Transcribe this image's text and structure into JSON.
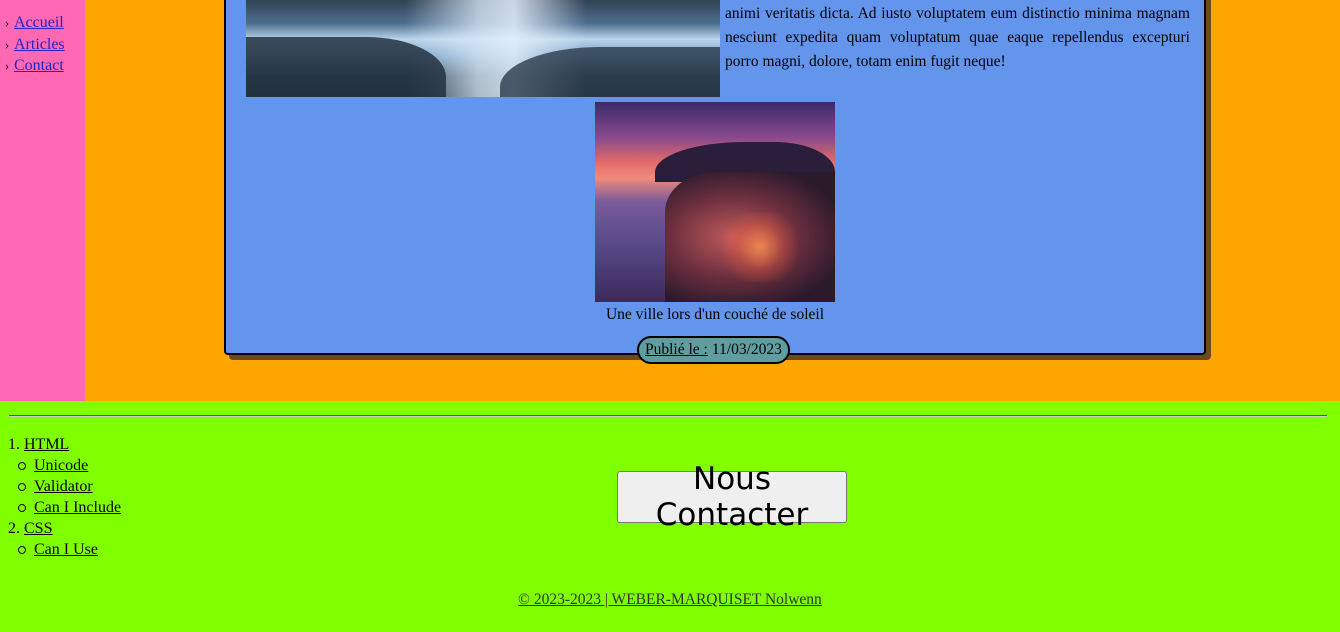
{
  "sidebar": {
    "items": [
      {
        "label": "Accueil"
      },
      {
        "label": "Articles"
      },
      {
        "label": "Contact"
      }
    ]
  },
  "article": {
    "text": "consequuntur porro? Reprehenderit, nam. Reprehenderit nulla similique animi veritatis dicta. Ad iusto voluptatem eum distinctio minima magnam nesciunt expedita quam voluptatum quae eaque repellendus excepturi porro magni, dolore, totam enim fugit neque!",
    "figure_caption": "Une ville lors d'un couché de soleil",
    "published_label": "Publié le :",
    "published_date": "11/03/2023"
  },
  "footer": {
    "links": [
      {
        "num": "1.",
        "label": "HTML",
        "children": [
          "Unicode",
          "Validator",
          "Can I Include"
        ]
      },
      {
        "num": "2.",
        "label": "CSS",
        "children": [
          "Can I Use"
        ]
      }
    ],
    "contact_button": "Nous Contacter",
    "copyright": "© 2023-2023 | WEBER-MARQUISET Nolwenn"
  },
  "colors": {
    "sidebar_bg": "#ff69b4",
    "main_bg": "#ffa500",
    "article_bg": "#6495ed",
    "badge_bg": "#5f9ea0",
    "footer_bg": "#7fff00",
    "link": "#2323c8"
  }
}
